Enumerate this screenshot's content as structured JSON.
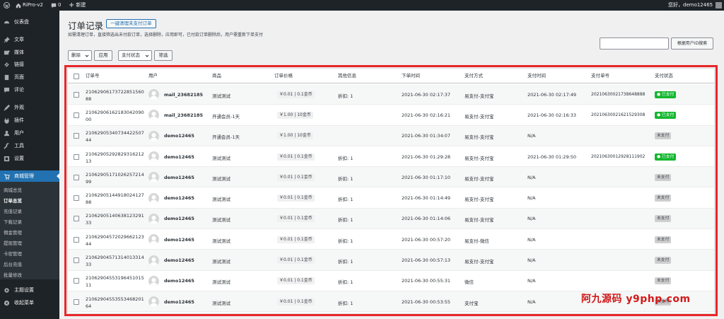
{
  "adminbar": {
    "site_name": "RiPro-v2",
    "comments_count": "0",
    "new_label": "新建",
    "greeting": "您好，demo12465"
  },
  "sidebar": {
    "items": [
      {
        "label": "仪表盘",
        "icon": "dashboard-icon"
      },
      {
        "label": "文章",
        "icon": "pin-icon"
      },
      {
        "label": "媒体",
        "icon": "media-icon"
      },
      {
        "label": "链接",
        "icon": "link-icon"
      },
      {
        "label": "页面",
        "icon": "page-icon"
      },
      {
        "label": "评论",
        "icon": "comment-icon"
      },
      {
        "label": "外观",
        "icon": "brush-icon"
      },
      {
        "label": "插件",
        "icon": "plugin-icon"
      },
      {
        "label": "用户",
        "icon": "user-icon"
      },
      {
        "label": "工具",
        "icon": "wrench-icon"
      },
      {
        "label": "设置",
        "icon": "settings-icon"
      },
      {
        "label": "商城管理",
        "icon": "cart-icon"
      }
    ],
    "submenu": [
      "商城总览",
      "订单总览",
      "充值记录",
      "下载记录",
      "佣金管理",
      "提现管理",
      "卡密管理",
      "后台充值",
      "批量修改"
    ],
    "bottom": [
      {
        "label": "主题设置",
        "icon": "gear-icon"
      },
      {
        "label": "收起菜单",
        "icon": "collapse-icon"
      }
    ]
  },
  "page": {
    "title": "订单记录",
    "title_action": "一键清理未支付订单",
    "intro": "如需清理订单，直接筛选出未付款订单，选择删除，应用即可，已付款订单删除后，用户需重新下单支付",
    "search_button": "根据用户ID搜索",
    "bulk_action": "删除",
    "apply": "应用",
    "pay_status_filter": "支付状态",
    "filter": "筛选"
  },
  "table": {
    "columns": [
      "订单号",
      "用户",
      "商品",
      "订单价格",
      "其他信息",
      "下单时间",
      "支付方式",
      "支付时间",
      "支付单号",
      "支付状态"
    ],
    "rows": [
      {
        "order_no": "2106290617372285156088",
        "user": "mail_23682185",
        "product": "测试测试",
        "price": "￥0.01 | 0.1金币",
        "extra": "折扣: 1",
        "order_time": "2021-06-30 02:17:37",
        "pay_method": "易支付-支付宝",
        "pay_time": "2021-06-30 02:17:49",
        "pay_no": "20210630021738648888",
        "status": "已支付",
        "paid": true
      },
      {
        "order_no": "2106290616218304209000",
        "user": "mail_23682185",
        "product": "开通会员-1天",
        "price": "￥1.00 | 10金币",
        "extra": "",
        "order_time": "2021-06-30 02:16:21",
        "pay_method": "易支付-支付宝",
        "pay_time": "2021-06-30 02:16:33",
        "pay_no": "20210630021621529308",
        "status": "已支付",
        "paid": true
      },
      {
        "order_no": "2106290534073442250744",
        "user": "demo12465",
        "product": "开通会员-1天",
        "price": "￥1.00 | 10金币",
        "extra": "",
        "order_time": "2021-06-30 01:34:07",
        "pay_method": "易支付-支付宝",
        "pay_time": "N/A",
        "pay_no": "",
        "status": "未支付",
        "paid": false
      },
      {
        "order_no": "2106290529282931621213",
        "user": "demo12465",
        "product": "测试测试",
        "price": "￥0.01 | 0.1金币",
        "extra": "折扣: 1",
        "order_time": "2021-06-30 01:29:28",
        "pay_method": "易支付-支付宝",
        "pay_time": "2021-06-30 01:29:50",
        "pay_no": "20210630012928111902",
        "status": "已支付",
        "paid": true
      },
      {
        "order_no": "2106290517102625721499",
        "user": "demo12465",
        "product": "测试测试",
        "price": "￥0.01 | 0.1金币",
        "extra": "折扣: 1",
        "order_time": "2021-06-30 01:17:10",
        "pay_method": "易支付-支付宝",
        "pay_time": "N/A",
        "pay_no": "",
        "status": "未支付",
        "paid": false
      },
      {
        "order_no": "2106290514491802412788",
        "user": "demo12465",
        "product": "测试测试",
        "price": "￥0.01 | 0.1金币",
        "extra": "折扣: 1",
        "order_time": "2021-06-30 01:14:49",
        "pay_method": "易支付-支付宝",
        "pay_time": "N/A",
        "pay_no": "",
        "status": "未支付",
        "paid": false
      },
      {
        "order_no": "2106290514063812329133",
        "user": "demo12465",
        "product": "测试测试",
        "price": "￥0.01 | 0.1金币",
        "extra": "折扣: 1",
        "order_time": "2021-06-30 01:14:06",
        "pay_method": "易支付-支付宝",
        "pay_time": "N/A",
        "pay_no": "",
        "status": "未支付",
        "paid": false
      },
      {
        "order_no": "2106290457202966212344",
        "user": "demo12465",
        "product": "测试测试",
        "price": "￥0.01 | 0.1金币",
        "extra": "折扣: 1",
        "order_time": "2021-06-30 00:57:20",
        "pay_method": "易支付-微信",
        "pay_time": "N/A",
        "pay_no": "",
        "status": "未支付",
        "paid": false
      },
      {
        "order_no": "2106290457131401331433",
        "user": "demo12465",
        "product": "测试测试",
        "price": "￥0.01 | 0.1金币",
        "extra": "折扣: 1",
        "order_time": "2021-06-30 00:57:13",
        "pay_method": "易支付-支付宝",
        "pay_time": "N/A",
        "pay_no": "",
        "status": "未支付",
        "paid": false
      },
      {
        "order_no": "2106290455319645101511",
        "user": "demo12465",
        "product": "测试测试",
        "price": "￥0.01 | 0.1金币",
        "extra": "折扣: 1",
        "order_time": "2021-06-30 00:55:31",
        "pay_method": "微信",
        "pay_time": "N/A",
        "pay_no": "",
        "status": "未支付",
        "paid": false
      },
      {
        "order_no": "2106290455355346820164",
        "user": "demo12465",
        "product": "测试测试",
        "price": "￥0.01 | 0.1金币",
        "extra": "折扣: 1",
        "order_time": "2021-06-30 00:53:55",
        "pay_method": "支付宝",
        "pay_time": "N/A",
        "pay_no": "",
        "status": "未支付",
        "paid": false
      }
    ]
  },
  "watermark": "阿九源码 y9php.com",
  "colors": {
    "accent": "#2271b1",
    "paid": "#12b82e",
    "frame": "#e8262a"
  }
}
